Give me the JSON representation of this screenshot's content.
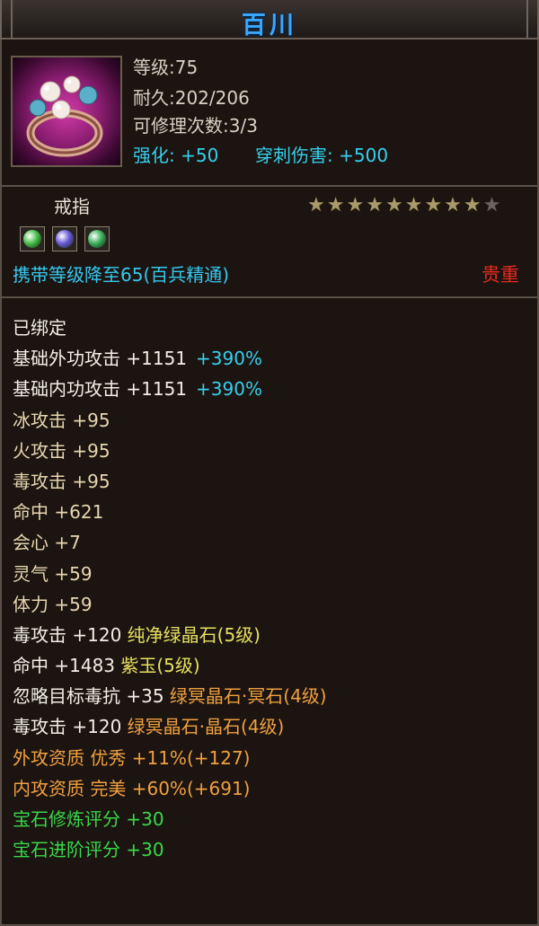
{
  "item_name": "百川",
  "level_line": "等级:75",
  "durability_line": "耐久:202/206",
  "repair_line": "可修理次数:3/3",
  "enhance": {
    "label": "强化:",
    "value": "+50",
    "pierce_label": "穿刺伤害:",
    "pierce_value": "+500"
  },
  "item_type": "戒指",
  "stars": {
    "filled": 9,
    "total": 10
  },
  "gems": [
    {
      "name": "green-gem",
      "color": "#46c04a"
    },
    {
      "name": "purple-gem",
      "color": "#6a5ad8"
    },
    {
      "name": "green-gem",
      "color": "#3ab05a"
    }
  ],
  "carry_requirement": "携带等级降至65(百兵精通)",
  "valuable_label": "贵重",
  "attributes": [
    {
      "text": "已绑定",
      "extra": "",
      "color": "white"
    },
    {
      "text": "基础外功攻击 +1151",
      "extra": "+390%",
      "color": "white"
    },
    {
      "text": "基础内功攻击 +1151",
      "extra": "+390%",
      "color": "white"
    },
    {
      "text": "冰攻击 +95",
      "extra": "",
      "color": "tan"
    },
    {
      "text": "火攻击 +95",
      "extra": "",
      "color": "tan"
    },
    {
      "text": "毒攻击 +95",
      "extra": "",
      "color": "tan"
    },
    {
      "text": "命中 +621",
      "extra": "",
      "color": "tan"
    },
    {
      "text": "会心 +7",
      "extra": "",
      "color": "tan"
    },
    {
      "text": "灵气 +59",
      "extra": "",
      "color": "tan"
    },
    {
      "text": "体力 +59",
      "extra": "",
      "color": "tan"
    },
    {
      "text": "毒攻击 +120 ",
      "extra": "纯净绿晶石(5级)",
      "color": "white",
      "extra_color": "yellow"
    },
    {
      "text": "命中 +1483 ",
      "extra": "紫玉(5级)",
      "color": "white",
      "extra_color": "yellow"
    },
    {
      "text": "忽略目标毒抗 +35 ",
      "extra": "绿冥晶石·冥石(4级)",
      "color": "white",
      "extra_color": "orange"
    },
    {
      "text": "毒攻击 +120 ",
      "extra": "绿冥晶石·晶石(4级)",
      "color": "white",
      "extra_color": "orange"
    },
    {
      "text": "外攻资质  优秀 +11%",
      "extra": "(+127)",
      "color": "orange",
      "extra_color": "orange"
    },
    {
      "text": "内攻资质  完美 +60%",
      "extra": "(+691)",
      "color": "orange",
      "extra_color": "orange"
    },
    {
      "text": "宝石修炼评分 +30",
      "extra": "",
      "color": "green"
    },
    {
      "text": "宝石进阶评分 +30",
      "extra": "",
      "color": "green"
    }
  ]
}
